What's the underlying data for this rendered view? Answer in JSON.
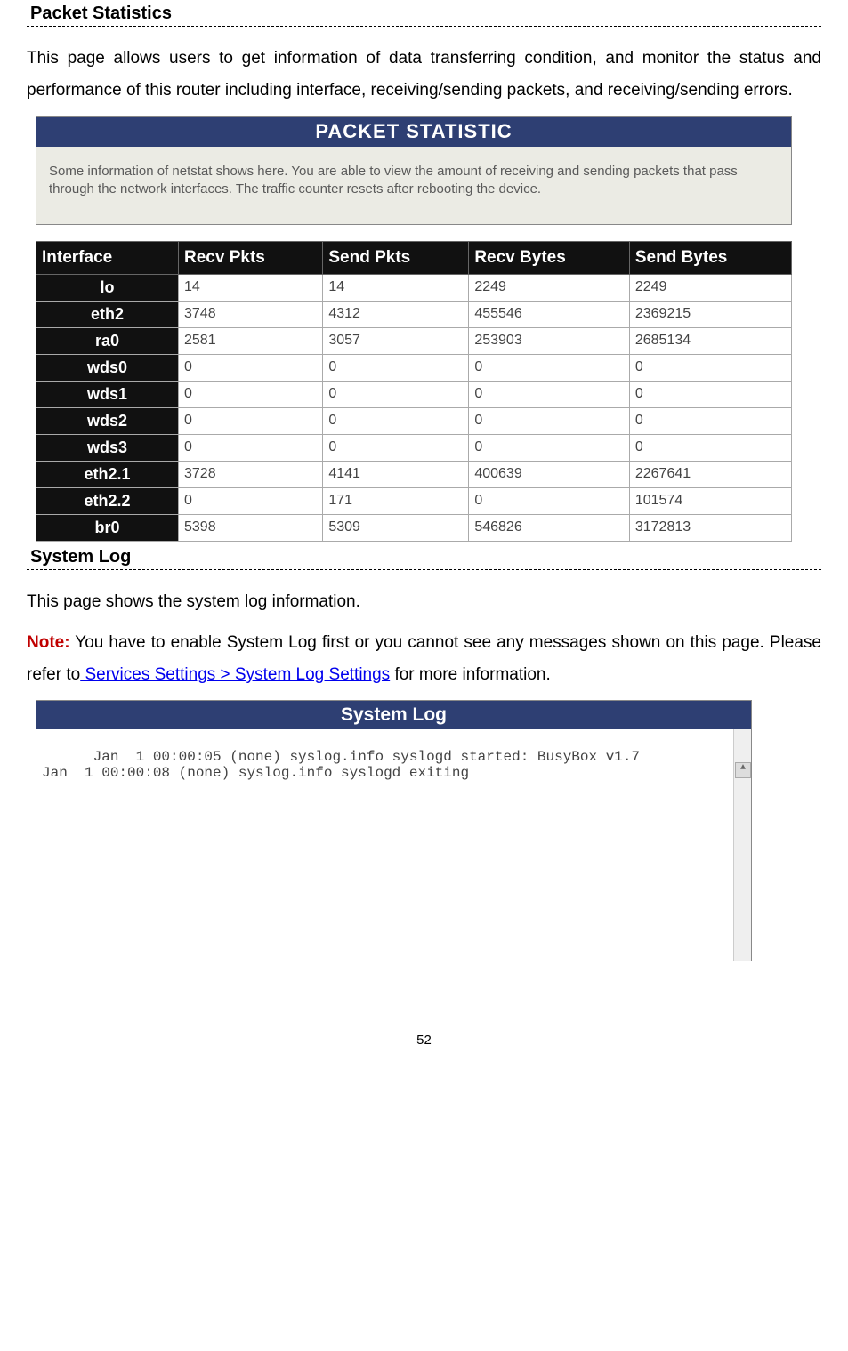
{
  "section1": {
    "title": "Packet Statistics",
    "body": "This page allows users to get information of data transferring condition, and monitor the status and performance of this router including interface, receiving/sending packets, and receiving/sending errors."
  },
  "packet_panel": {
    "title": "PACKET STATISTIC",
    "desc": "Some information of netstat shows here. You are able to view the amount of receiving and sending packets that pass through the network interfaces. The traffic counter resets after rebooting the device."
  },
  "stats_headers": [
    "Interface",
    "Recv Pkts",
    "Send Pkts",
    "Recv Bytes",
    "Send Bytes"
  ],
  "stats_rows": [
    {
      "iface": "lo",
      "rp": "14",
      "sp": "14",
      "rb": "2249",
      "sb": "2249"
    },
    {
      "iface": "eth2",
      "rp": "3748",
      "sp": "4312",
      "rb": "455546",
      "sb": "2369215"
    },
    {
      "iface": "ra0",
      "rp": "2581",
      "sp": "3057",
      "rb": "253903",
      "sb": "2685134"
    },
    {
      "iface": "wds0",
      "rp": "0",
      "sp": "0",
      "rb": "0",
      "sb": "0"
    },
    {
      "iface": "wds1",
      "rp": "0",
      "sp": "0",
      "rb": "0",
      "sb": "0"
    },
    {
      "iface": "wds2",
      "rp": "0",
      "sp": "0",
      "rb": "0",
      "sb": "0"
    },
    {
      "iface": "wds3",
      "rp": "0",
      "sp": "0",
      "rb": "0",
      "sb": "0"
    },
    {
      "iface": "eth2.1",
      "rp": "3728",
      "sp": "4141",
      "rb": "400639",
      "sb": "2267641"
    },
    {
      "iface": "eth2.2",
      "rp": "0",
      "sp": "171",
      "rb": "0",
      "sb": "101574"
    },
    {
      "iface": "br0",
      "rp": "5398",
      "sp": "5309",
      "rb": "546826",
      "sb": "3172813"
    }
  ],
  "section2": {
    "title": "System Log",
    "body": "This page shows the system log information.",
    "note_label": "Note:",
    "note_before": " You have to enable System Log first or you cannot see any messages shown on this page. Please refer to",
    "note_link": " Services Settings > System Log Settings",
    "note_after": " for more information."
  },
  "syslog_panel": {
    "title": "System Log",
    "lines": "Jan  1 00:00:05 (none) syslog.info syslogd started: BusyBox v1.7\nJan  1 00:00:08 (none) syslog.info syslogd exiting"
  },
  "page_number": "52"
}
